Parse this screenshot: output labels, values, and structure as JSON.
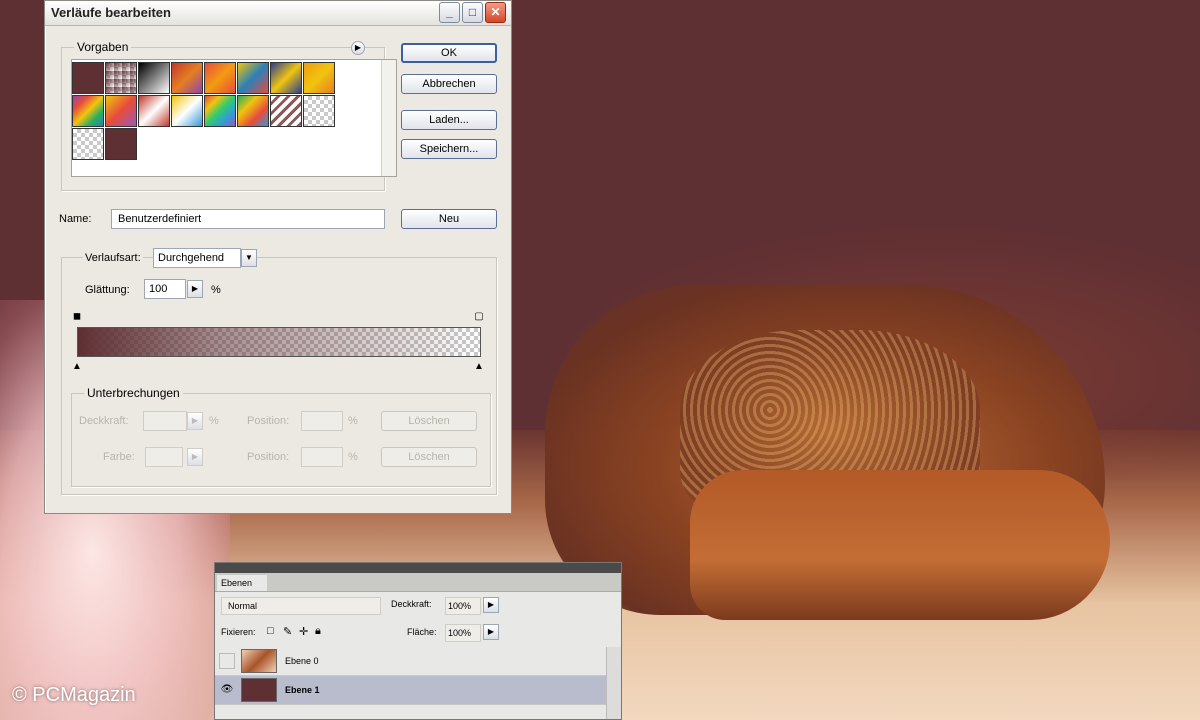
{
  "dialog": {
    "title": "Verläufe bearbeiten",
    "window_buttons": {
      "minimize": "_",
      "maximize": "□",
      "close": "✕"
    },
    "presets_label": "Vorgaben",
    "buttons": {
      "ok": "OK",
      "cancel": "Abbrechen",
      "load": "Laden...",
      "save": "Speichern...",
      "new": "Neu"
    },
    "name_label": "Name:",
    "name_value": "Benutzerdefiniert",
    "gradient_type_label": "Verlaufsart:",
    "gradient_type_value": "Durchgehend",
    "smoothness_label": "Glättung:",
    "smoothness_value": "100",
    "percent": "%",
    "stops_group_label": "Unterbrechungen",
    "opacity_label": "Deckkraft:",
    "position_label": "Position:",
    "color_label": "Farbe:",
    "delete_label": "Löschen"
  },
  "layers_panel": {
    "tab_label": "Ebenen",
    "blend_mode": "Normal",
    "opacity_label": "Deckkraft:",
    "opacity_value": "100%",
    "lock_label": "Fixieren:",
    "fill_label": "Fläche:",
    "fill_value": "100%",
    "layers": [
      {
        "name": "Ebene 0",
        "visible": false,
        "selected": false
      },
      {
        "name": "Ebene 1",
        "visible": true,
        "selected": true
      }
    ]
  },
  "watermark": "© PCMagazin",
  "colors": {
    "foreground": "#5e2f33",
    "accent_button_border": "#3e5f9e"
  }
}
